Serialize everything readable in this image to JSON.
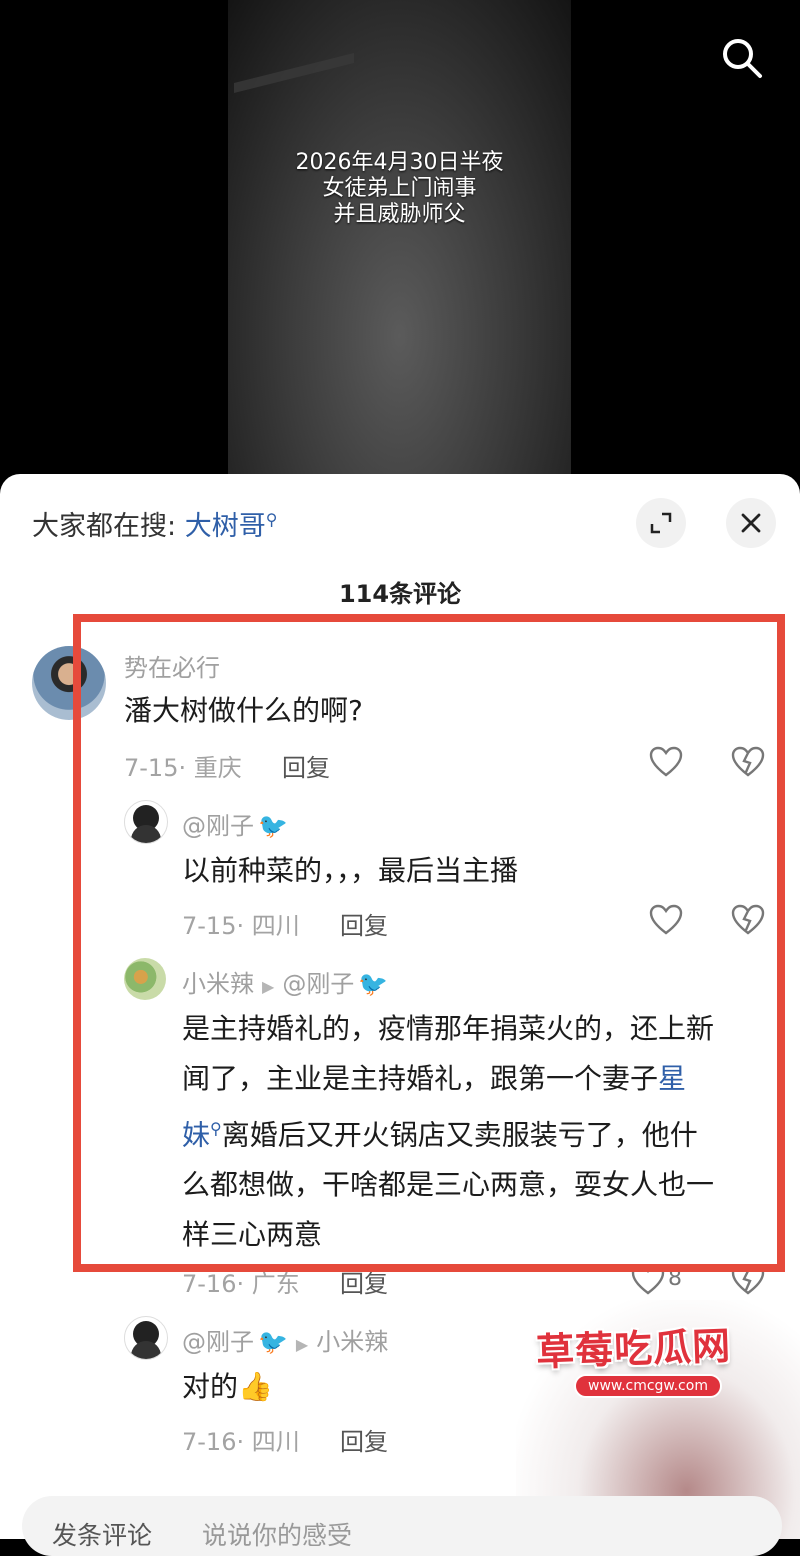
{
  "video": {
    "caption": [
      "2026年4月30日半夜",
      "女徒弟上门闹事",
      "并且威胁师父"
    ]
  },
  "sheet": {
    "trending_prefix": "大家都在搜:",
    "trending_keyword": "大树哥",
    "comment_count": "114条评论"
  },
  "comments": [
    {
      "user": "势在必行",
      "text": "潘大树做什么的啊?",
      "date": "7-15",
      "location": "重庆",
      "reply_label": "回复",
      "likes": ""
    },
    {
      "user": "@刚子",
      "text": "以前种菜的，，，最后当主播",
      "date": "7-15",
      "location": "四川",
      "reply_label": "回复",
      "likes": ""
    },
    {
      "user": "小米辣",
      "reply_to": "@刚子",
      "text_lines": [
        "是主持婚礼的，疫情那年捐菜火的，还上新",
        "闻了，主业是主持婚礼，跟第一个妻子",
        "离婚后又开火锅店又卖服装亏了，他什",
        "么都想做，干啥都是三心两意，耍女人也一",
        "样三心两意"
      ],
      "link_part1": "星",
      "link_part2": "妹",
      "date": "7-16",
      "location": "广东",
      "reply_label": "回复",
      "likes": "8"
    },
    {
      "user": "@刚子",
      "reply_to": "小米辣",
      "text": "对的",
      "emoji": "👍",
      "date": "7-16",
      "location": "四川",
      "reply_label": "回复",
      "likes": ""
    }
  ],
  "input": {
    "label": "发条评论",
    "placeholder": "说说你的感受"
  },
  "watermark": {
    "title": "草莓吃瓜网",
    "url": "www.cmcgw.com"
  },
  "colors": {
    "highlight_border": "#e64a3b",
    "link": "#2f5fa8",
    "watermark": "#e0323c"
  }
}
